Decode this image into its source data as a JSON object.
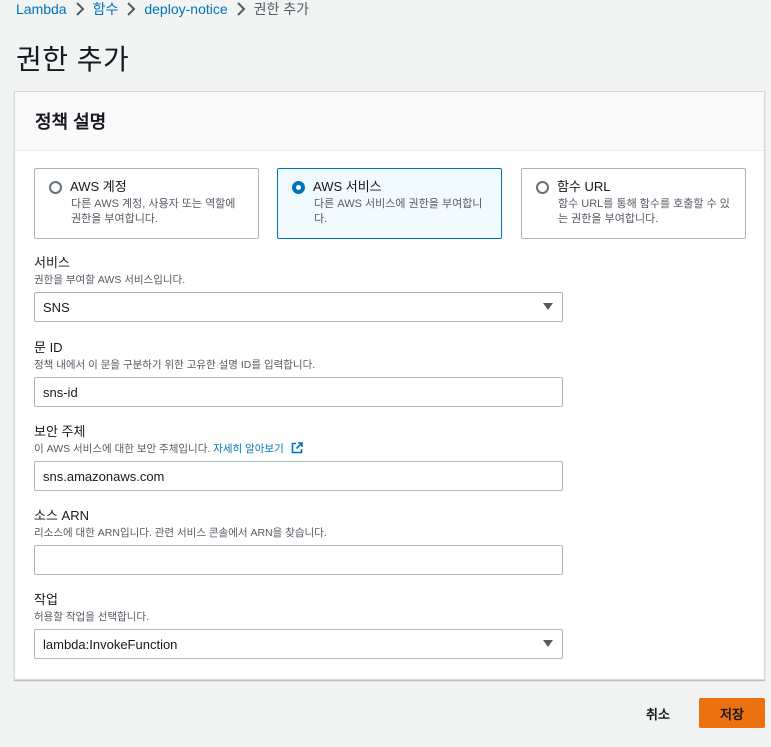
{
  "breadcrumb": {
    "items": [
      "Lambda",
      "함수",
      "deploy-notice"
    ],
    "current": "권한 추가"
  },
  "page_title": "권한 추가",
  "panel": {
    "title": "정책 설명",
    "principal_options": [
      {
        "label": "AWS 계정",
        "description": "다른 AWS 계정, 사용자 또는 역할에 권한을 부여합니다.",
        "selected": false
      },
      {
        "label": "AWS 서비스",
        "description": "다른 AWS 서비스에 권한을 부여합니다.",
        "selected": true
      },
      {
        "label": "함수 URL",
        "description": "함수 URL를 통해 함수를 호출할 수 있는 권한을 부여합니다.",
        "selected": false
      }
    ],
    "fields": {
      "service": {
        "label": "서비스",
        "description": "권한을 부여할 AWS 서비스입니다.",
        "value": "SNS"
      },
      "statement_id": {
        "label": "문 ID",
        "description": "정책 내에서 이 문을 구분하기 위한 고유한 설명 ID를 입력합니다.",
        "value": "sns-id"
      },
      "principal": {
        "label": "보안 주체",
        "description": "이 AWS 서비스에 대한 보안 주체입니다.",
        "learn_more": "자세히 알아보기",
        "value": "sns.amazonaws.com"
      },
      "source_arn": {
        "label": "소스 ARN",
        "description": "리소스에 대한 ARN입니다. 관련 서비스 콘솔에서 ARN을 찾습니다.",
        "value": ""
      },
      "action": {
        "label": "작업",
        "description": "허용할 작업을 선택합니다.",
        "value": "lambda:InvokeFunction"
      }
    }
  },
  "actions": {
    "cancel": "취소",
    "save": "저장"
  },
  "colors": {
    "link": "#0073bb",
    "primary_button": "#ec7211",
    "selected_border": "#0073bb"
  }
}
